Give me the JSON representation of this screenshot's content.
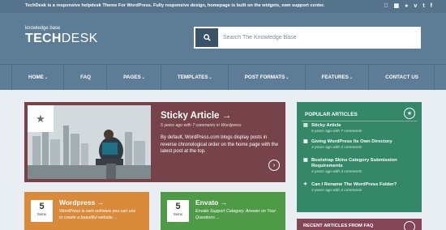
{
  "topbar": {
    "message": "TechDesk is a responsive helpdesk Theme For WordPress. Fully responsive design, homepage is built on the widgets, own support center.",
    "social_icons": [
      "apple-icon",
      "windows-icon",
      "flickr-icon",
      "vimeo-icon",
      "twitter-icon",
      "facebook-icon"
    ]
  },
  "brand": {
    "tagline": "knowledge base",
    "name_bold": "TECH",
    "name_light": "DESK"
  },
  "search": {
    "placeholder": "Search The Knowledge Base"
  },
  "nav": {
    "items": [
      {
        "label": "HOME",
        "has_caret": true
      },
      {
        "label": "FAQ",
        "has_caret": false
      },
      {
        "label": "PAGES",
        "has_caret": true
      },
      {
        "label": "TEMPLATES",
        "has_caret": true
      },
      {
        "label": "POST FORMATS",
        "has_caret": true
      },
      {
        "label": "FEATURES",
        "has_caret": true
      },
      {
        "label": "CONTACT US",
        "has_caret": false
      }
    ]
  },
  "sticky": {
    "title": "Sticky Article →",
    "meta": "5 years ago with 7 comments in Wordpress",
    "excerpt": "By default, WordPress.com blogs display posts in reverse chronological order on the home page with the latest post at the top."
  },
  "categories": [
    {
      "title": "Wordpress →",
      "count": "5",
      "count_label": "Items",
      "description": "WordPress is web software you can use to create a beautiful website ...",
      "color": "#d98a3a"
    },
    {
      "title": "Envato →",
      "count": "5",
      "count_label": "Items",
      "description": "Envato Support Category. Answer on Your Questions ...",
      "color": "#4e9a46"
    }
  ],
  "popular": {
    "heading": "POPULAR ARTICLES",
    "articles": [
      {
        "icon": "document-icon",
        "title": "Sticky Article",
        "meta": "5 years ago with 7 comments"
      },
      {
        "icon": "image-icon",
        "title": "Giving WordPress Its Own Directory",
        "meta": "4 years ago with 4 comments"
      },
      {
        "icon": "image-icon",
        "title": "Bootstrap Skins Category Submission Requirements",
        "meta": "4 years ago with 4 comments"
      },
      {
        "icon": "pin-icon",
        "title": "Can I Rename The WordPress Folder?",
        "meta": "4 years ago with 4 comments"
      }
    ]
  },
  "recent": {
    "heading": "RECENT ARTICLES FROM FAQ"
  },
  "colors": {
    "topbar": "#55738b",
    "header": "#5d7c96",
    "sticky": "#76434a",
    "sidebar": "#35876a",
    "recent": "#844559",
    "background": "#e8eef2"
  }
}
